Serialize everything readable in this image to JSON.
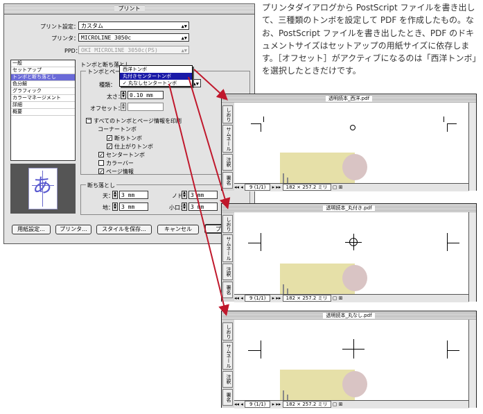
{
  "print_dialog": {
    "title": "プリント",
    "preset_label": "プリント設定：",
    "preset_value": "カスタム",
    "printer_label": "プリンタ：",
    "printer_value": "MICROLINE 3050c",
    "ppd_label": "PPD：",
    "ppd_value": "OKI MICROLINE 3050c(PS)",
    "categories": [
      "一般",
      "セットアップ",
      "トンボと断ち落とし",
      "色分解",
      "グラフィック",
      "カラーマネージメント",
      "詳細",
      "概要"
    ],
    "selected_category": "トンボと断ち落とし",
    "section_marks_label": "トンボと断ち落とし",
    "marks_group_label": "トンボとページ",
    "type_label": "種類：",
    "weight_label": "太さ：",
    "weight_value": "0.10 mm",
    "offset_label": "オフセット：",
    "all_marks_label": "すべてのトンボとページ情報を印刷",
    "corner_marks_label": "コーナートンボ",
    "checkboxes": [
      {
        "label": "断ちトンボ",
        "checked": true
      },
      {
        "label": "仕上がりトンボ",
        "checked": true
      },
      {
        "label": "センタートンボ",
        "checked": true
      },
      {
        "label": "カラーバー",
        "checked": false
      },
      {
        "label": "ページ情報",
        "checked": true
      }
    ],
    "preview_glyph": "あ",
    "bleed_group_label": "断ち落とし",
    "bleed_top_label": "天：",
    "bleed_top_value": "3 mm",
    "bleed_bottom_label": "地：",
    "bleed_bottom_value": "3 mm",
    "bleed_inside_label": "ノド：",
    "bleed_inside_value": "3 mm",
    "bleed_outside_label": "小口：",
    "bleed_outside_value": "3 mm",
    "buttons": {
      "page_setup": "用紙設定...",
      "printer": "プリンタ...",
      "save_style": "スタイルを保存...",
      "cancel": "キャンセル",
      "print": "プ"
    }
  },
  "mark_type_menu": {
    "items": [
      "西洋トンボ",
      "丸付きセンタートンボ",
      "丸なしセンタートンボ"
    ],
    "highlighted": "丸付きセンタートンボ",
    "checked": "丸なしセンタートンボ"
  },
  "description": "プリンタダイアログから PostScript ファイルを書き出して、三種類のトンボを設定して PDF を作成したもの。なお、PostScript ファイルを書き出したとき、PDF のドキュメントサイズはセットアップの用紙サイズに依存します。［オフセット］がアクティブになるのは「西洋トンボ」を選択したときだけです。",
  "pdf_windows": [
    {
      "title": "透明読本_西洋.pdf",
      "page_indicator": "9 (1/1)",
      "page_size": "182 × 257.2 ミリ"
    },
    {
      "title": "透明読本_丸付き.pdf",
      "page_indicator": "9 (1/1)",
      "page_size": "182 × 257.2 ミリ"
    },
    {
      "title": "透明読本_丸なし.pdf",
      "page_indicator": "9 (1/1)",
      "page_size": "182 × 257.2 ミリ"
    }
  ],
  "sidebar_tabs": [
    "しおり",
    "サムネール",
    "注釈",
    "署名"
  ],
  "colors": {
    "arrow": "#c0182c",
    "menu_highlight": "#1a1aa8",
    "selection": "#6a6ad8",
    "art_yellow": "#e6e0a8"
  }
}
